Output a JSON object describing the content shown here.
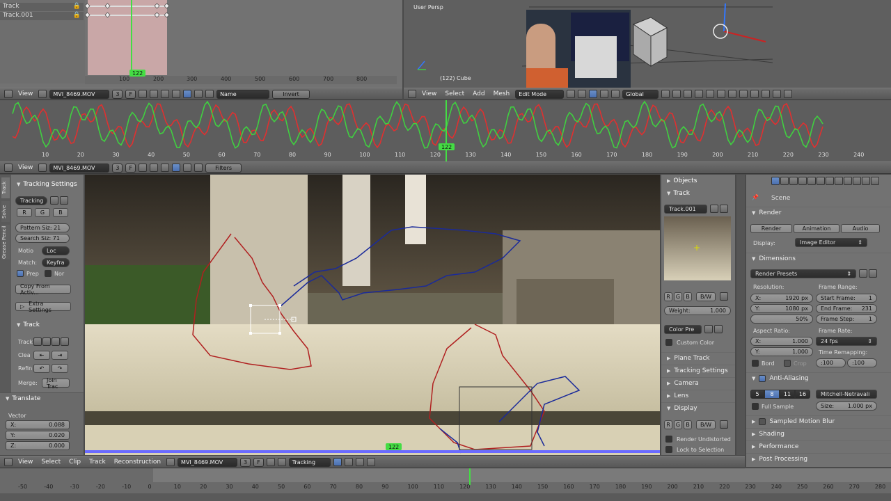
{
  "dopesheet": {
    "tracks": [
      "Track",
      "Track.001"
    ],
    "frame_badge": "122",
    "ticks": [
      "100",
      "200",
      "300",
      "400",
      "500",
      "600",
      "700",
      "800"
    ]
  },
  "clip_header_top": {
    "view": "View",
    "clip_name": "MVI_8469.MOV",
    "users": "3",
    "f": "F",
    "sort": "Name",
    "invert": "Invert"
  },
  "viewport": {
    "persp": "User Persp",
    "object": "(122) Cube",
    "menus": [
      "View",
      "Select",
      "Add",
      "Mesh"
    ],
    "mode": "Edit Mode",
    "orientation": "Global"
  },
  "graph": {
    "frame_badge": "122",
    "ticks": [
      "10",
      "20",
      "30",
      "40",
      "50",
      "60",
      "70",
      "80",
      "90",
      "100",
      "110",
      "120",
      "130",
      "140",
      "150",
      "160",
      "170",
      "180",
      "190",
      "200",
      "210",
      "220",
      "230",
      "240"
    ]
  },
  "graph_header": {
    "view": "View",
    "clip_name": "MVI_8469.MOV",
    "users": "3",
    "f": "F",
    "filters": "Filters"
  },
  "tool_panel": {
    "tabs": [
      "Track",
      "Solve",
      "Grease Pencil"
    ],
    "tracking_settings": "Tracking Settings",
    "preset": "Tracking",
    "rgb": [
      "R",
      "G",
      "B"
    ],
    "pattern": "Pattern Siz: 21",
    "search": "Search Siz: 71",
    "motion_lbl": "Motio",
    "motion_val": "Loc",
    "match_lbl": "Match:",
    "match_val": "Keyfra",
    "prepass": "Prep",
    "normalize": "Nor",
    "copy": "Copy From Activ...",
    "extra": "Extra Settings",
    "track": "Track",
    "track_lbl": "Track",
    "clear_lbl": "Clea",
    "refine_lbl": "Refin",
    "merge_lbl": "Merge:",
    "join": "Join Trac",
    "translate": "Translate",
    "vector": "Vector",
    "x": "X:",
    "x_val": "0.088",
    "y": "Y:",
    "y_val": "0.020",
    "z": "Z:",
    "z_val": "0.000"
  },
  "clip_view": {
    "frame_badge": "122"
  },
  "properties": {
    "objects": "Objects",
    "track": "Track",
    "track_name": "Track.001",
    "rgb": [
      "R",
      "G",
      "B"
    ],
    "bw": "B/W",
    "weight": "Weight:",
    "weight_val": "1.000",
    "color_preset": "Color Pre",
    "custom_color": "Custom Color",
    "sections": [
      "Plane Track",
      "Tracking Settings",
      "Camera",
      "Lens"
    ],
    "display": "Display",
    "render_undistorted": "Render Undistorted",
    "lock_selection": "Lock to Selection"
  },
  "render_panel": {
    "scene": "Scene",
    "render": "Render",
    "btn_render": "Render",
    "btn_animation": "Animation",
    "btn_audio": "Audio",
    "display_lbl": "Display:",
    "display_val": "Image Editor",
    "dimensions": "Dimensions",
    "presets": "Render Presets",
    "resolution": "Resolution:",
    "res_x": "1920 px",
    "res_y": "1080 px",
    "res_pct": "50%",
    "frame_range": "Frame Range:",
    "start": "Start Frame:",
    "start_val": "1",
    "end": "End Frame:",
    "end_val": "231",
    "step": "Frame Step:",
    "step_val": "1",
    "aspect": "Aspect Ratio:",
    "asp_x": "1.000",
    "asp_y": "1.000",
    "frame_rate": "Frame Rate:",
    "fps": "24 fps",
    "time_remap": "Time Remapping:",
    "remap_old": ":100",
    "remap_new": ":100",
    "border": "Bord",
    "crop": "Crop",
    "anti_alias": "Anti-Aliasing",
    "aa_samples": [
      "5",
      "8",
      "11",
      "16"
    ],
    "filter": "Mitchell-Netravali",
    "full_sample": "Full Sample",
    "size_lbl": "Size:",
    "size_val": "1.000 px",
    "collapsed": [
      "Sampled Motion Blur",
      "Shading",
      "Performance",
      "Post Processing"
    ]
  },
  "clip_header_bottom": {
    "menus": [
      "View",
      "Select",
      "Clip",
      "Track",
      "Reconstruction"
    ],
    "clip_name": "MVI_8469.MOV",
    "users": "3",
    "f": "F",
    "mode": "Tracking"
  },
  "timeline": {
    "ticks": [
      "-50",
      "-40",
      "-30",
      "-20",
      "-10",
      "0",
      "10",
      "20",
      "30",
      "40",
      "50",
      "60",
      "70",
      "80",
      "90",
      "100",
      "110",
      "120",
      "130",
      "140",
      "150",
      "160",
      "170",
      "180",
      "190",
      "200",
      "210",
      "220",
      "230",
      "240",
      "250",
      "260",
      "270",
      "280"
    ]
  },
  "colors": {
    "track_red": "#b02020",
    "track_blue": "#1a2a9a",
    "frame_green": "#44dd44",
    "selected_blue": "#5680c2"
  }
}
